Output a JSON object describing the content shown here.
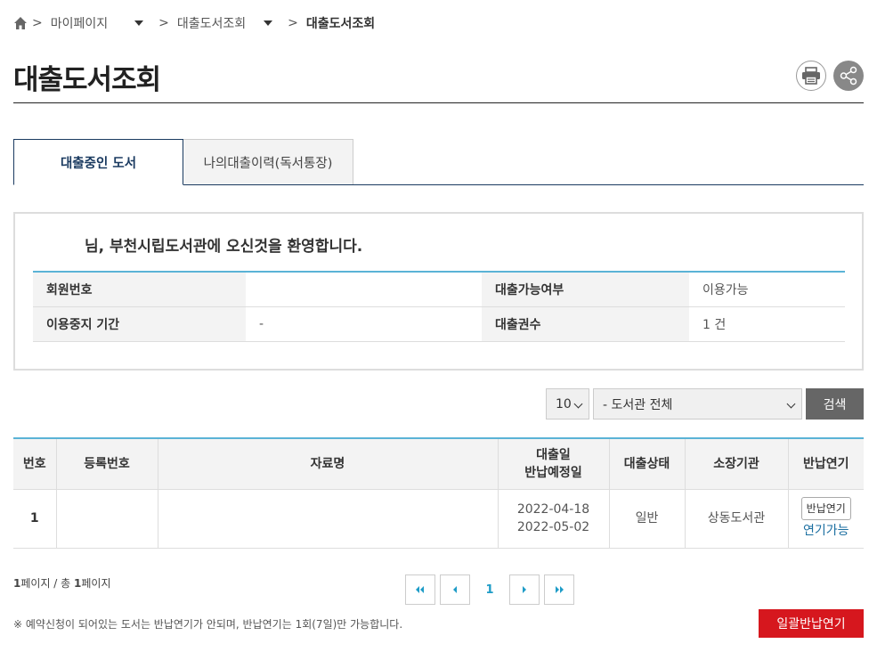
{
  "breadcrumb": {
    "sep": ">",
    "items": [
      "마이페이지",
      "대출도서조회"
    ],
    "current": "대출도서조회"
  },
  "page": {
    "title": "대출도서조회"
  },
  "tabs": [
    {
      "label": "대출중인 도서",
      "active": true
    },
    {
      "label": "나의대출이력(독서통장)",
      "active": false
    }
  ],
  "welcome": {
    "message": "님, 부천시립도서관에 오신것을 환영합니다.",
    "rows": [
      {
        "label1": "회원번호",
        "value1": "",
        "label2": "대출가능여부",
        "value2": "이용가능"
      },
      {
        "label1": "이용중지 기간",
        "value1": "-",
        "label2": "대출권수",
        "value2": "1 건"
      }
    ]
  },
  "search": {
    "count_value": "10",
    "library_value": "- 도서관 전체",
    "button_label": "검색"
  },
  "loan_table": {
    "headers": [
      "번호",
      "등록번호",
      "자료명",
      "대출일",
      "반납예정일",
      "대출상태",
      "소장기관",
      "반납연기"
    ],
    "rows": [
      {
        "no": "1",
        "reg_no": "",
        "title": "",
        "loan_date": "2022-04-18",
        "due_date": "2022-05-02",
        "status": "일반",
        "library": "상동도서관",
        "renew_button": "반납연기",
        "renew_status": "연기가능"
      }
    ]
  },
  "pagination": {
    "current_page": "1",
    "page_word": "페이지",
    "total_prefix": " / 총 ",
    "total_pages": "1",
    "total_suffix": "페이지"
  },
  "footer": {
    "note": "※ 예약신청이 되어있는 도서는 반납연기가 안되며, 반납연기는 1회(7일)만 가능합니다.",
    "bulk_button": "일괄반납연기"
  },
  "colors": {
    "navy": "#1a3a60",
    "accent_blue": "#5ab3d6",
    "red": "#d6171e"
  }
}
